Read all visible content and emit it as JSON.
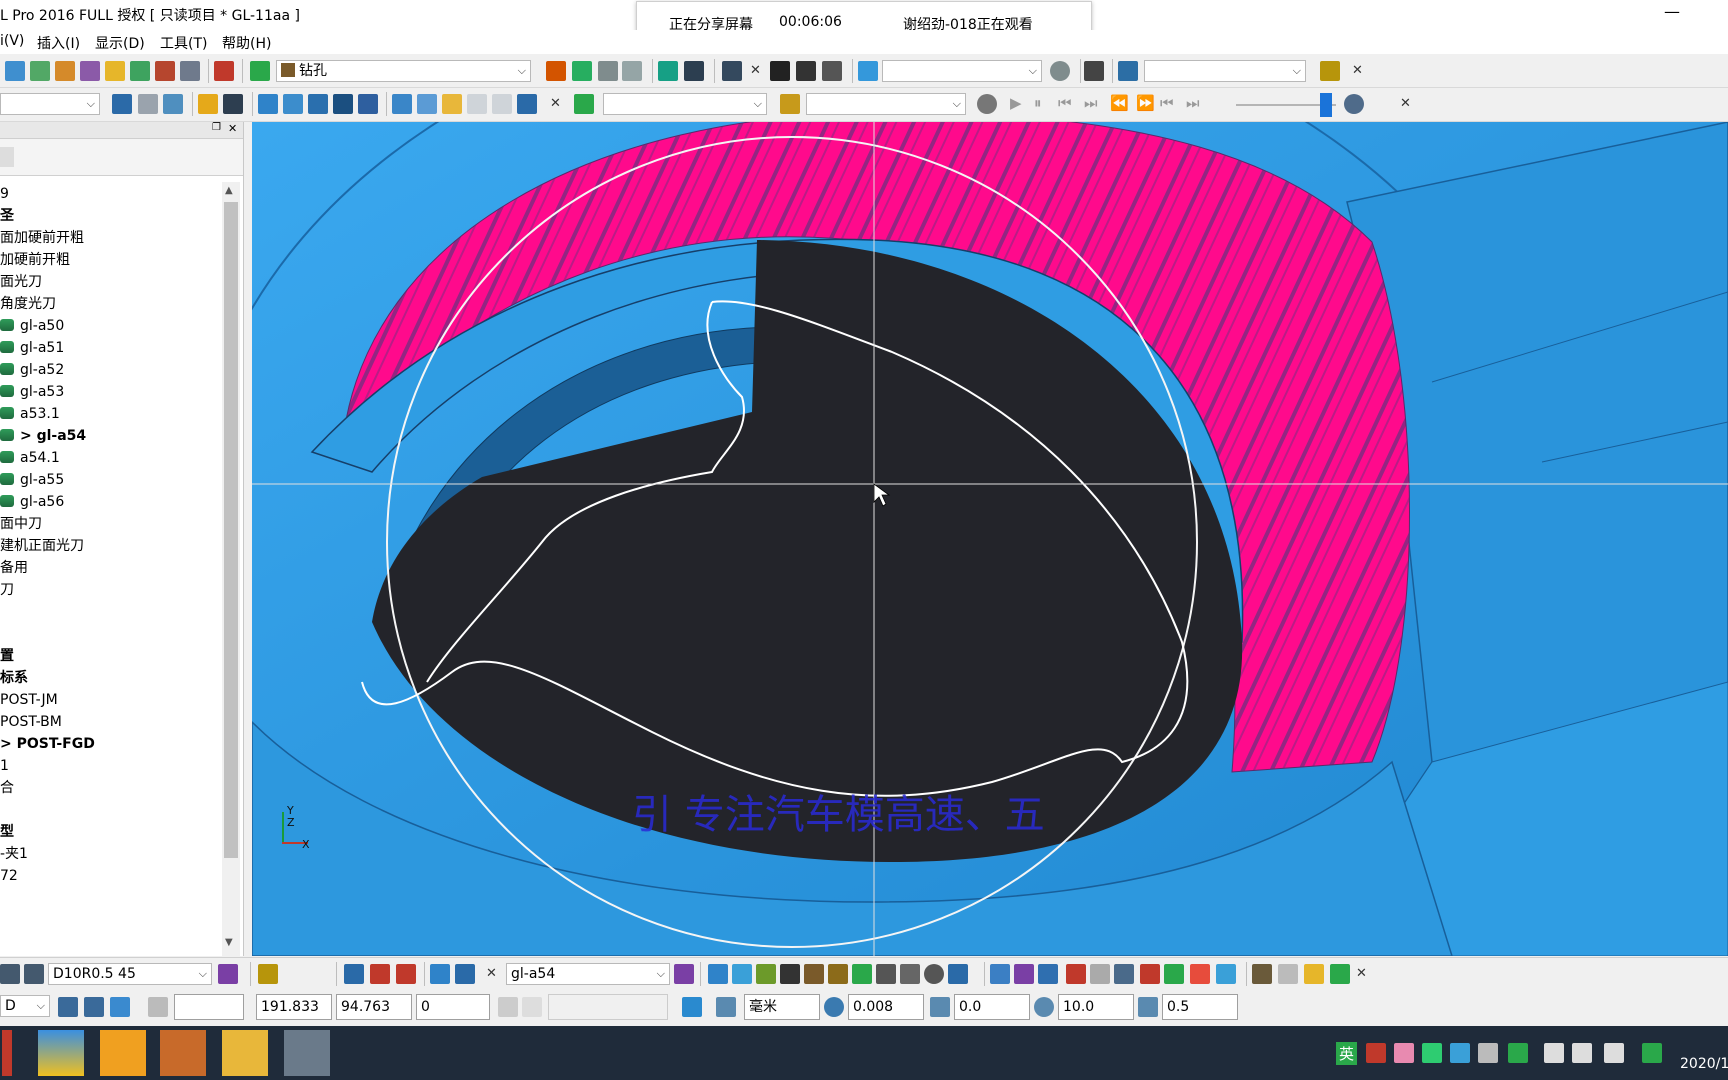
{
  "window": {
    "title": "L Pro 2016 FULL 授权   [ 只读项目 * GL-11aa ]",
    "minimize": "—"
  },
  "share_bar": {
    "status": "正在分享屏幕",
    "timer": "00:06:06",
    "viewer": "谢绍劲-018正在观看"
  },
  "menu": [
    "i(V)",
    "插入(I)",
    "显示(D)",
    "工具(T)",
    "帮助(H)"
  ],
  "toolbar1": {
    "strategy_label": "钻孔",
    "combo2": "",
    "combo3": ""
  },
  "toolbar2": {
    "combo_left": "",
    "combo_mid": "",
    "combo_right": "",
    "slider_position_percent": 90
  },
  "tree": [
    {
      "text": "9",
      "bold": false,
      "icon": false
    },
    {
      "text": "圣",
      "bold": true,
      "icon": false
    },
    {
      "text": "面加硬前开粗",
      "bold": false,
      "icon": false
    },
    {
      "text": "加硬前开粗",
      "bold": false,
      "icon": false
    },
    {
      "text": "面光刀",
      "bold": false,
      "icon": false
    },
    {
      "text": "角度光刀",
      "bold": false,
      "icon": false
    },
    {
      "text": "gl-a50",
      "bold": false,
      "icon": true
    },
    {
      "text": "gl-a51",
      "bold": false,
      "icon": true
    },
    {
      "text": "gl-a52",
      "bold": false,
      "icon": true
    },
    {
      "text": "gl-a53",
      "bold": false,
      "icon": true
    },
    {
      "text": "a53.1",
      "bold": false,
      "icon": true
    },
    {
      "text": "> gl-a54",
      "bold": true,
      "icon": true
    },
    {
      "text": "a54.1",
      "bold": false,
      "icon": true
    },
    {
      "text": "gl-a55",
      "bold": false,
      "icon": true
    },
    {
      "text": "gl-a56",
      "bold": false,
      "icon": true
    },
    {
      "text": "面中刀",
      "bold": false,
      "icon": false
    },
    {
      "text": "建机正面光刀",
      "bold": false,
      "icon": false
    },
    {
      "text": "备用",
      "bold": false,
      "icon": false
    },
    {
      "text": "刀",
      "bold": false,
      "icon": false
    },
    {
      "text": "",
      "bold": false,
      "icon": false
    },
    {
      "text": "",
      "bold": false,
      "icon": false
    },
    {
      "text": "置",
      "bold": true,
      "icon": false
    },
    {
      "text": "标系",
      "bold": true,
      "icon": false
    },
    {
      "text": "POST-JM",
      "bold": false,
      "icon": false
    },
    {
      "text": "POST-BM",
      "bold": false,
      "icon": false
    },
    {
      "text": "> POST-FGD",
      "bold": true,
      "icon": false
    },
    {
      "text": "1",
      "bold": false,
      "icon": false
    },
    {
      "text": "合",
      "bold": false,
      "icon": false
    },
    {
      "text": "",
      "bold": false,
      "icon": false
    },
    {
      "text": "型",
      "bold": true,
      "icon": false
    },
    {
      "text": "-夹1",
      "bold": false,
      "icon": false
    },
    {
      "text": "72",
      "bold": false,
      "icon": false
    }
  ],
  "viewport": {
    "watermark": "引  专注汽车模高速、五",
    "axis_y": "Y",
    "axis_z": "Z",
    "axis_x": "X",
    "colors": {
      "model_blue": "#2c9ae0",
      "pocket_dark": "#23242a",
      "wall_pink": "#ff0a8c"
    }
  },
  "bottom_toolbar1": {
    "tool": "D10R0.5  45",
    "toolpath": "gl-a54"
  },
  "bottom_toolbar2": {
    "mode": "D",
    "blank": "",
    "x": "191.833",
    "y": "94.763",
    "z": "0",
    "status": "",
    "units": "毫米",
    "tolerance": "0.008",
    "thickness": "0.0",
    "diameter": "10.0",
    "stepover": "0.5"
  },
  "taskbar": {
    "ime": "英",
    "clock": "2020/1"
  }
}
